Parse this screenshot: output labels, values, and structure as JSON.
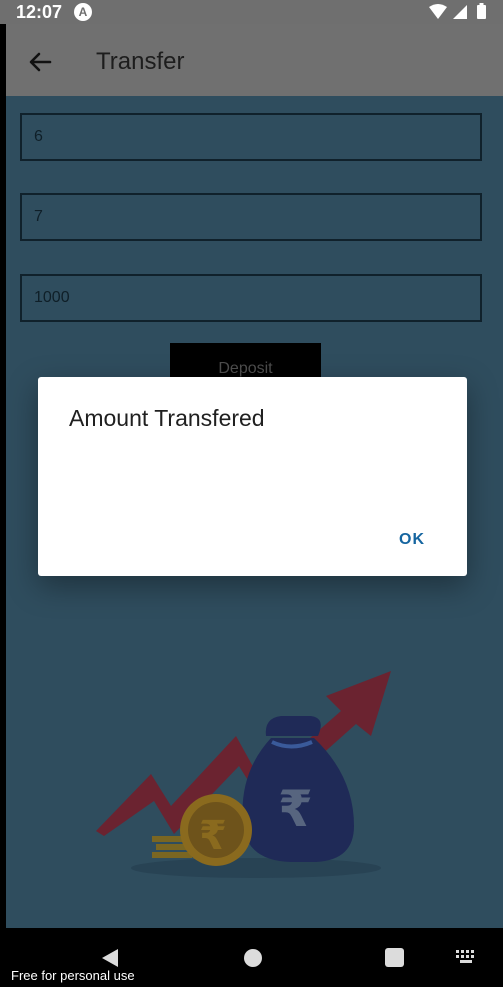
{
  "status_bar": {
    "time": "12:07",
    "app_badge": "A",
    "icons": [
      "wifi-icon",
      "signal-icon",
      "battery-icon"
    ]
  },
  "app_bar": {
    "title": "Transfer",
    "back_icon": "arrow-left-icon"
  },
  "form": {
    "from_account": "6",
    "to_account": "7",
    "amount": "1000",
    "deposit_label": "Deposit"
  },
  "dialog": {
    "title": "Amount Transfered",
    "ok_label": "OK"
  },
  "nav_bar": {
    "icons": [
      "back-triangle-icon",
      "home-circle-icon",
      "recents-square-icon",
      "keyboard-icon"
    ]
  },
  "watermark": "Free for personal use",
  "colors": {
    "background": "#2f4d5e",
    "app_bar": "#707070",
    "dialog_accent": "#1565a0"
  }
}
